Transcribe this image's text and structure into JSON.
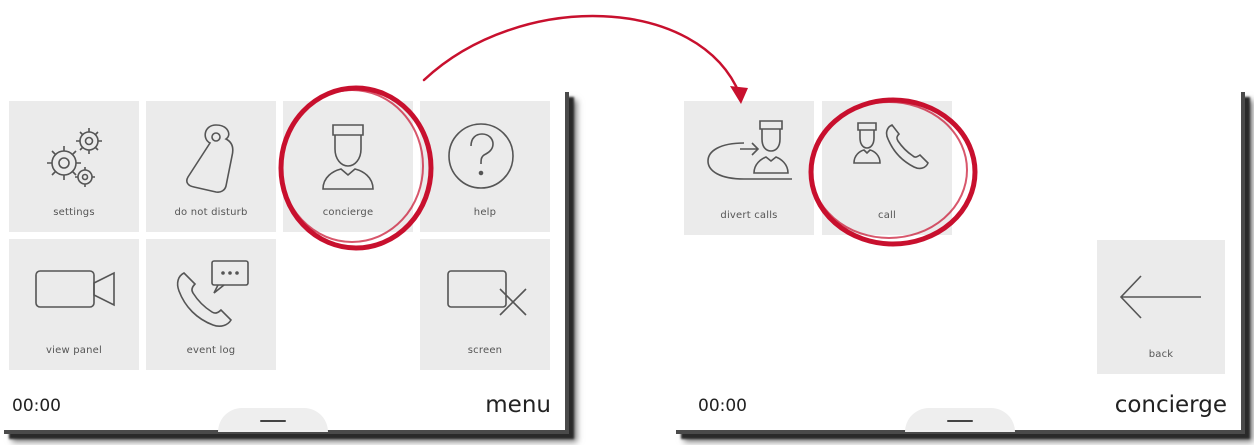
{
  "left_screen": {
    "tiles": [
      {
        "label": "settings",
        "icon": "gears-icon"
      },
      {
        "label": "do not disturb",
        "icon": "door-hanger-icon"
      },
      {
        "label": "concierge",
        "icon": "concierge-icon"
      },
      {
        "label": "help",
        "icon": "question-icon"
      },
      {
        "label": "view panel",
        "icon": "video-camera-icon"
      },
      {
        "label": "event log",
        "icon": "phone-chat-icon"
      },
      {
        "label": "screen",
        "icon": "screen-off-icon"
      }
    ],
    "clock": "00:00",
    "title": "menu"
  },
  "right_screen": {
    "tiles": [
      {
        "label": "divert calls",
        "icon": "divert-calls-icon"
      },
      {
        "label": "call",
        "icon": "call-concierge-icon"
      },
      {
        "label": "back",
        "icon": "back-arrow-icon"
      }
    ],
    "clock": "00:00",
    "title": "concierge"
  },
  "colors": {
    "highlight": "#c8102e",
    "tile": "#ebebeb",
    "icon_stroke": "#555555"
  }
}
